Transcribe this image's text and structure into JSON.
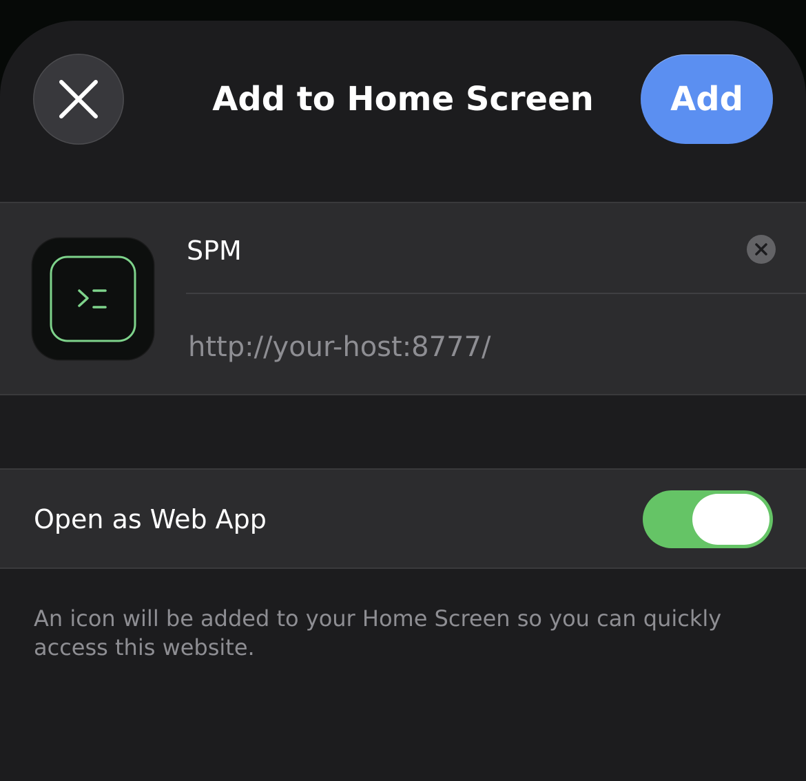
{
  "header": {
    "title": "Add to Home Screen",
    "add_label": "Add",
    "close_icon": "close-icon"
  },
  "app": {
    "icon": "terminal-prompt-icon",
    "name": "SPM",
    "url": "http://your-host:8777/",
    "clear_icon": "clear-text-icon"
  },
  "settings": {
    "web_app_label": "Open as Web App",
    "web_app_enabled": true
  },
  "footnote": "An icon will be added to your Home Screen so you can quickly access this website.",
  "colors": {
    "accent": "#5b8ff1",
    "toggle_on": "#65c466",
    "icon_outline": "#7ed38b"
  }
}
